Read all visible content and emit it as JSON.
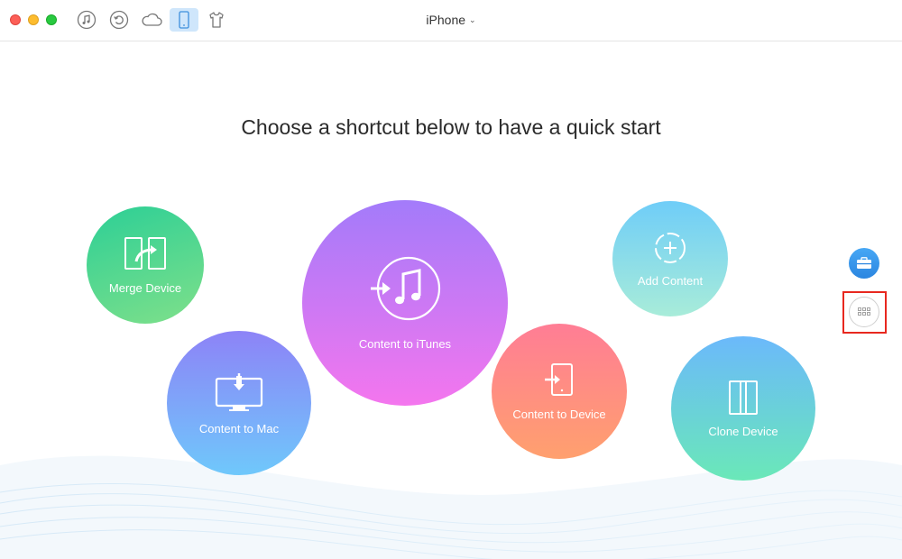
{
  "titlebar": {
    "device_name": "iPhone",
    "tools": [
      {
        "name": "itunes-library-icon",
        "active": false
      },
      {
        "name": "backup-icon",
        "active": false
      },
      {
        "name": "icloud-icon",
        "active": false
      },
      {
        "name": "device-icon",
        "active": true
      },
      {
        "name": "theme-shirt-icon",
        "active": false
      }
    ]
  },
  "main": {
    "headline": "Choose a shortcut below to have a quick start",
    "shortcuts": {
      "merge_device": {
        "label": "Merge Device",
        "icon": "merge-device-icon"
      },
      "content_to_mac": {
        "label": "Content to Mac",
        "icon": "monitor-download-icon"
      },
      "content_to_itunes": {
        "label": "Content to iTunes",
        "icon": "itunes-note-icon"
      },
      "content_to_device": {
        "label": "Content to Device",
        "icon": "phone-import-icon"
      },
      "add_content": {
        "label": "Add Content",
        "icon": "add-circle-icon"
      },
      "clone_device": {
        "label": "Clone Device",
        "icon": "clone-device-icon"
      }
    }
  },
  "side": {
    "toolbox_icon": "toolbox-icon",
    "more_icon": "grid-dots-icon"
  },
  "colors": {
    "accent": "#2b86e0",
    "highlight": "#e8281f",
    "active_tab": "#cfe6fb"
  }
}
